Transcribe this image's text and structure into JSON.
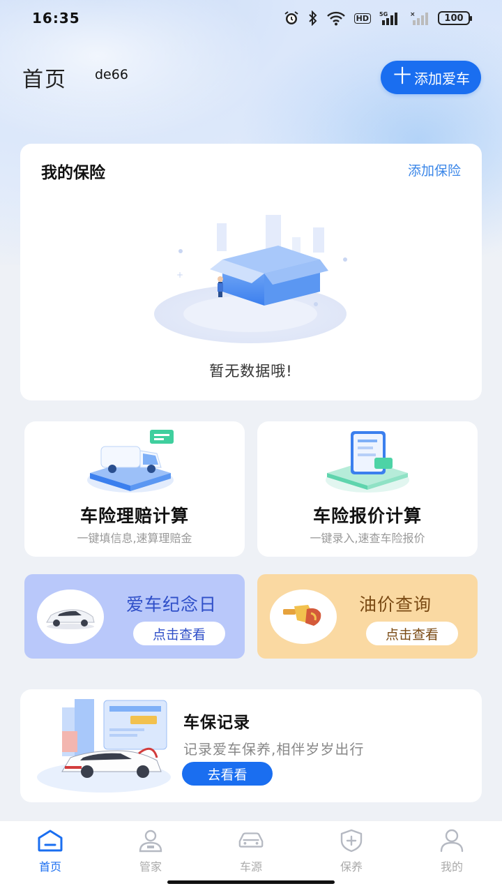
{
  "status_bar": {
    "time": "16:35",
    "hd_label": "HD",
    "network_label": "5G",
    "battery": "100"
  },
  "header": {
    "title": "首页",
    "username": "de66",
    "add_car_plus": "十",
    "add_car_label": "添加爱车"
  },
  "insurance": {
    "title": "我的保险",
    "add_link": "添加保险",
    "empty_text": "暂无数据哦!"
  },
  "tools": [
    {
      "title": "车险理赔计算",
      "subtitle": "一键填信息,速算理赔金"
    },
    {
      "title": "车险报价计算",
      "subtitle": "一键录入,速查车险报价"
    }
  ],
  "features": [
    {
      "title": "爱车纪念日",
      "button": "点击查看",
      "color": "#b9c8fa"
    },
    {
      "title": "油价查询",
      "button": "点击查看",
      "color": "#fad9a2"
    }
  ],
  "record": {
    "title": "车保记录",
    "subtitle": "记录爱车保养,相伴岁岁出行",
    "button": "去看看"
  },
  "bottom_nav": {
    "items": [
      {
        "label": "首页",
        "icon": "home-icon",
        "active": true
      },
      {
        "label": "管家",
        "icon": "butler-icon",
        "active": false
      },
      {
        "label": "车源",
        "icon": "car-icon",
        "active": false
      },
      {
        "label": "保养",
        "icon": "shield-plus-icon",
        "active": false
      },
      {
        "label": "我的",
        "icon": "user-icon",
        "active": false
      }
    ]
  },
  "colors": {
    "primary": "#1a6ef0",
    "link": "#3a86e8"
  }
}
